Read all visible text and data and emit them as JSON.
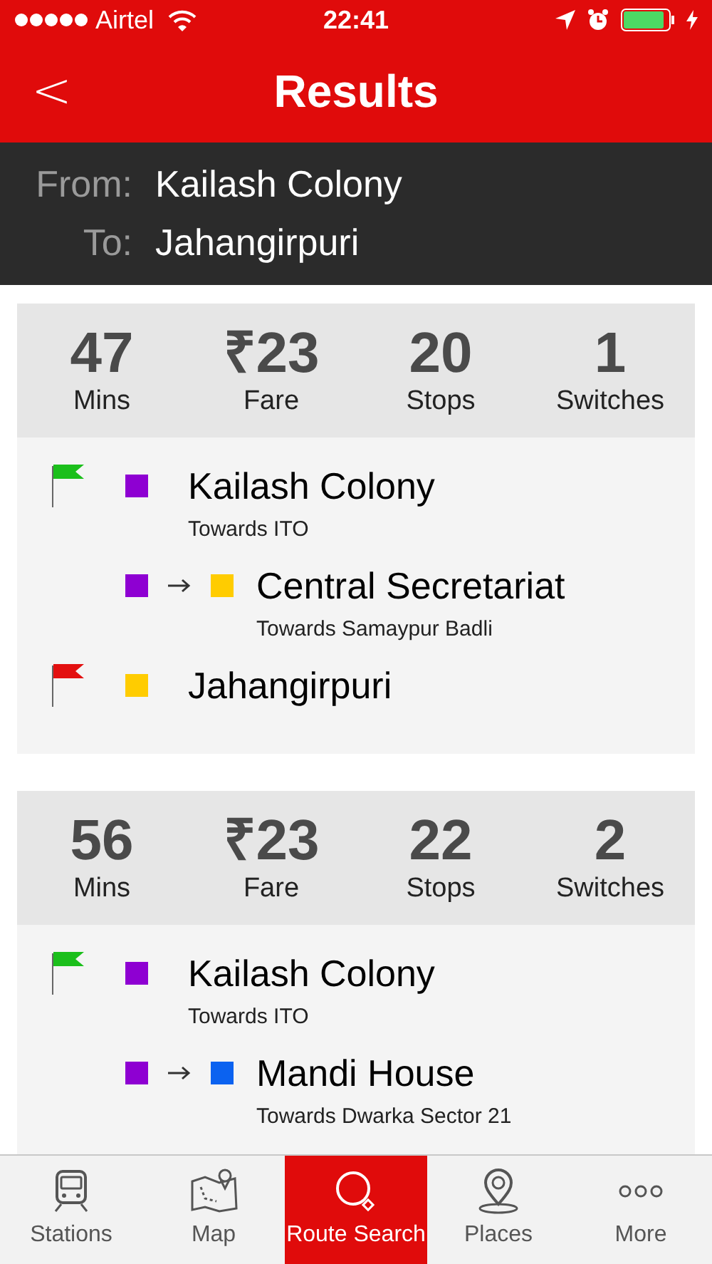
{
  "status_bar": {
    "carrier": "Airtel",
    "time": "22:41"
  },
  "nav": {
    "back": "<",
    "title": "Results"
  },
  "query": {
    "from_label": "From:",
    "from": "Kailash Colony",
    "to_label": "To:",
    "to": "Jahangirpuri"
  },
  "routes": [
    {
      "stats": [
        {
          "value": "47",
          "label": "Mins"
        },
        {
          "value": "₹23",
          "label": "Fare"
        },
        {
          "value": "20",
          "label": "Stops"
        },
        {
          "value": "1",
          "label": "Switches"
        }
      ],
      "legs": [
        {
          "kind": "start",
          "lines": [
            {
              "color": "#8e00d2"
            }
          ],
          "station": "Kailash Colony",
          "towards": "Towards ITO"
        },
        {
          "kind": "change",
          "lines": [
            {
              "color": "#8e00d2"
            },
            {
              "color": "#ffcc00"
            }
          ],
          "station": "Central Secretariat",
          "towards": "Towards Samaypur Badli"
        },
        {
          "kind": "end",
          "lines": [
            {
              "color": "#ffcc00"
            }
          ],
          "station": "Jahangirpuri"
        }
      ]
    },
    {
      "stats": [
        {
          "value": "56",
          "label": "Mins"
        },
        {
          "value": "₹23",
          "label": "Fare"
        },
        {
          "value": "22",
          "label": "Stops"
        },
        {
          "value": "2",
          "label": "Switches"
        }
      ],
      "legs": [
        {
          "kind": "start",
          "lines": [
            {
              "color": "#8e00d2"
            }
          ],
          "station": "Kailash Colony",
          "towards": "Towards ITO"
        },
        {
          "kind": "change",
          "lines": [
            {
              "color": "#8e00d2"
            },
            {
              "color": "#0b62f0"
            }
          ],
          "station": "Mandi House",
          "towards": "Towards Dwarka Sector 21"
        }
      ]
    }
  ],
  "tabs": [
    {
      "kind": "stations",
      "label": "Stations",
      "selected": false
    },
    {
      "kind": "map",
      "label": "Map",
      "selected": false
    },
    {
      "kind": "route",
      "label": "Route Search",
      "selected": true
    },
    {
      "kind": "places",
      "label": "Places",
      "selected": false
    },
    {
      "kind": "more",
      "label": "More",
      "selected": false
    }
  ]
}
